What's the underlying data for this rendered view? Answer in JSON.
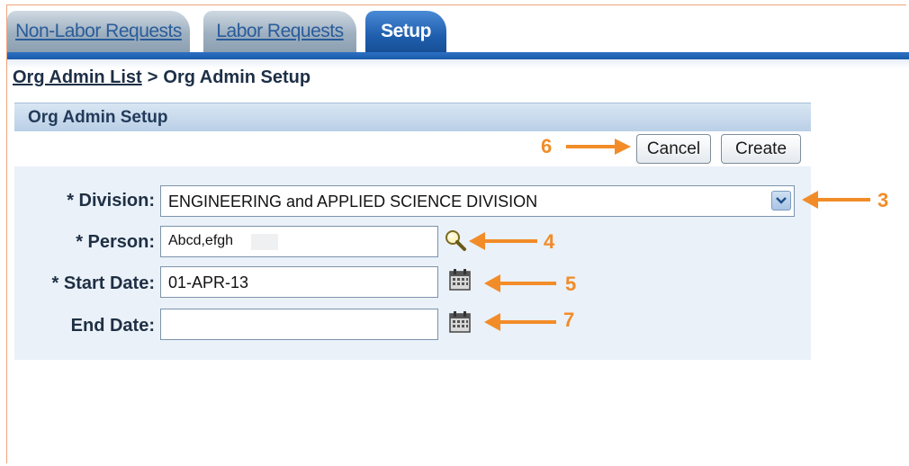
{
  "tabs": [
    {
      "label": "Non-Labor Requests",
      "state": "inactive"
    },
    {
      "label": "Labor Requests",
      "state": "inactive"
    },
    {
      "label": "Setup",
      "state": "active"
    }
  ],
  "breadcrumb": {
    "link": "Org Admin List",
    "separator": ">",
    "current": "Org Admin Setup"
  },
  "section": {
    "title": "Org Admin Setup"
  },
  "buttons": {
    "cancel": "Cancel",
    "create": "Create"
  },
  "form": {
    "division": {
      "label": "* Division:",
      "value": "ENGINEERING and APPLIED SCIENCE DIVISION"
    },
    "person": {
      "label": "* Person:",
      "value": "Abcd,efgh"
    },
    "start_date": {
      "label": "* Start Date:",
      "value": "01-APR-13"
    },
    "end_date": {
      "label": "End Date:",
      "value": ""
    }
  },
  "annotations": {
    "cancel_marker": "6",
    "division_marker": "3",
    "person_marker": "4",
    "start_marker": "5",
    "end_marker": "7"
  },
  "colors": {
    "tab_active": "#1f5fae",
    "tab_inactive": "#9eb0c0",
    "annotation": "#f28c28",
    "section_bg": "#eaf1f8"
  },
  "icons": {
    "dropdown": "chevron-down-icon",
    "person_lookup": "search-icon",
    "start_picker": "calendar-icon",
    "end_picker": "calendar-icon"
  }
}
